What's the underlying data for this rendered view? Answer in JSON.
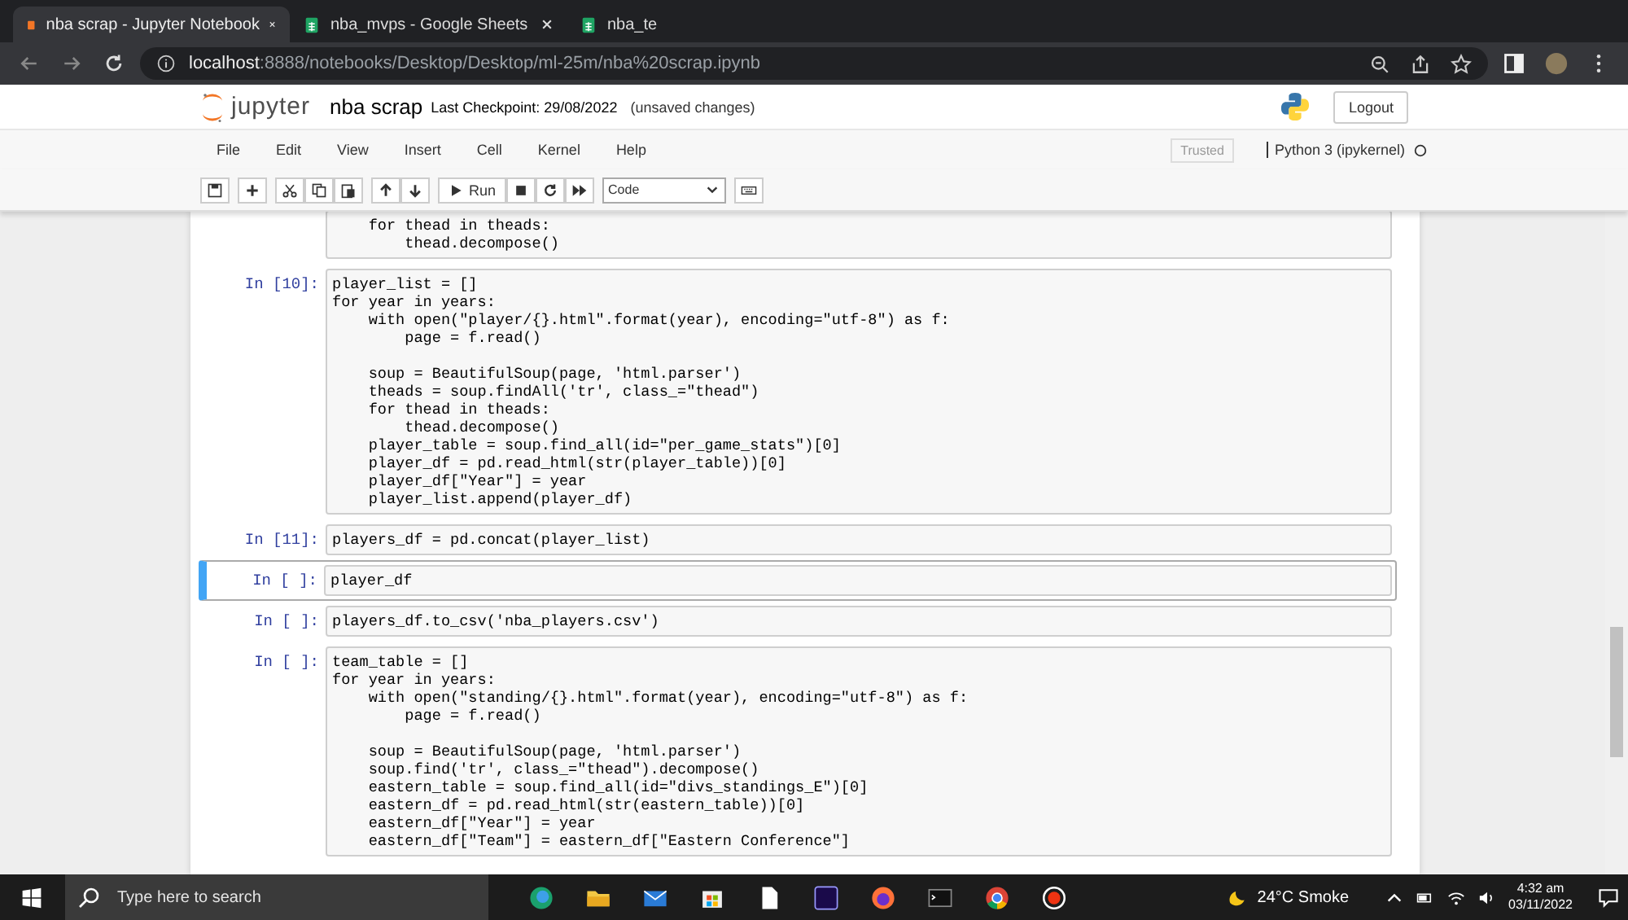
{
  "browser": {
    "tabs": [
      {
        "title": "nba scrap - Jupyter Notebook",
        "selected": true,
        "kind": "jupyter"
      },
      {
        "title": "nba_mvps - Google Sheets",
        "selected": false,
        "kind": "sheets"
      },
      {
        "title": "nba_te",
        "selected": false,
        "kind": "sheets"
      }
    ],
    "url_host": "localhost",
    "url_path": ":8888/notebooks/Desktop/Desktop/ml-25m/nba%20scrap.ipynb"
  },
  "header": {
    "logo": "jupyter",
    "title": "nba scrap",
    "checkpoint": "Last Checkpoint: 29/08/2022",
    "status": "(unsaved changes)",
    "logout": "Logout"
  },
  "menu": [
    "File",
    "Edit",
    "View",
    "Insert",
    "Cell",
    "Kernel",
    "Help"
  ],
  "trusted": "Trusted",
  "kernel": "Python 3 (ipykernel)",
  "toolbar": {
    "run": "Run",
    "cell_type": "Code"
  },
  "cells": [
    {
      "selected": false,
      "blocks": [
        [
          "    for thead in theads:",
          "        thead.decompose()"
        ]
      ]
    },
    {
      "prompt": "In [10]:",
      "selected": false,
      "blocks": [
        [
          "player_list = []",
          "for year in years:",
          "    with open(\"player/{}.html\".format(year), encoding=\"utf-8\") as f:",
          "        page = f.read()"
        ],
        [
          "    soup = BeautifulSoup(page, 'html.parser')",
          "    theads = soup.findAll('tr', class_=\"thead\")",
          "    for thead in theads:",
          "        thead.decompose()",
          "    player_table = soup.find_all(id=\"per_game_stats\")[0]",
          "    player_df = pd.read_html(str(player_table))[0]",
          "    player_df[\"Year\"] = year",
          "    player_list.append(player_df)"
        ]
      ]
    },
    {
      "prompt": "In [11]:",
      "selected": false,
      "blocks": [
        [
          "players_df = pd.concat(player_list)"
        ]
      ]
    },
    {
      "prompt": "In [ ]:",
      "selected": true,
      "blocks": [
        [
          "player_df"
        ]
      ]
    },
    {
      "prompt": "In [ ]:",
      "selected": false,
      "blocks": [
        [
          "players_df.to_csv('nba_players.csv')"
        ]
      ]
    },
    {
      "prompt": "In [ ]:",
      "selected": false,
      "blocks": [
        [
          "team_table = []",
          "for year in years:",
          "    with open(\"standing/{}.html\".format(year), encoding=\"utf-8\") as f:",
          "        page = f.read()"
        ],
        [
          "    soup = BeautifulSoup(page, 'html.parser')",
          "    soup.find('tr', class_=\"thead\").decompose()",
          "    eastern_table = soup.find_all(id=\"divs_standings_E\")[0]",
          "    eastern_df = pd.read_html(str(eastern_table))[0]",
          "    eastern_df[\"Year\"] = year",
          "    eastern_df[\"Team\"] = eastern_df[\"Eastern Conference\"]"
        ]
      ]
    }
  ],
  "taskbar": {
    "search_placeholder": "Type here to search",
    "weather": "24°C  Smoke",
    "time": "4:32 am",
    "date": "03/11/2022"
  }
}
